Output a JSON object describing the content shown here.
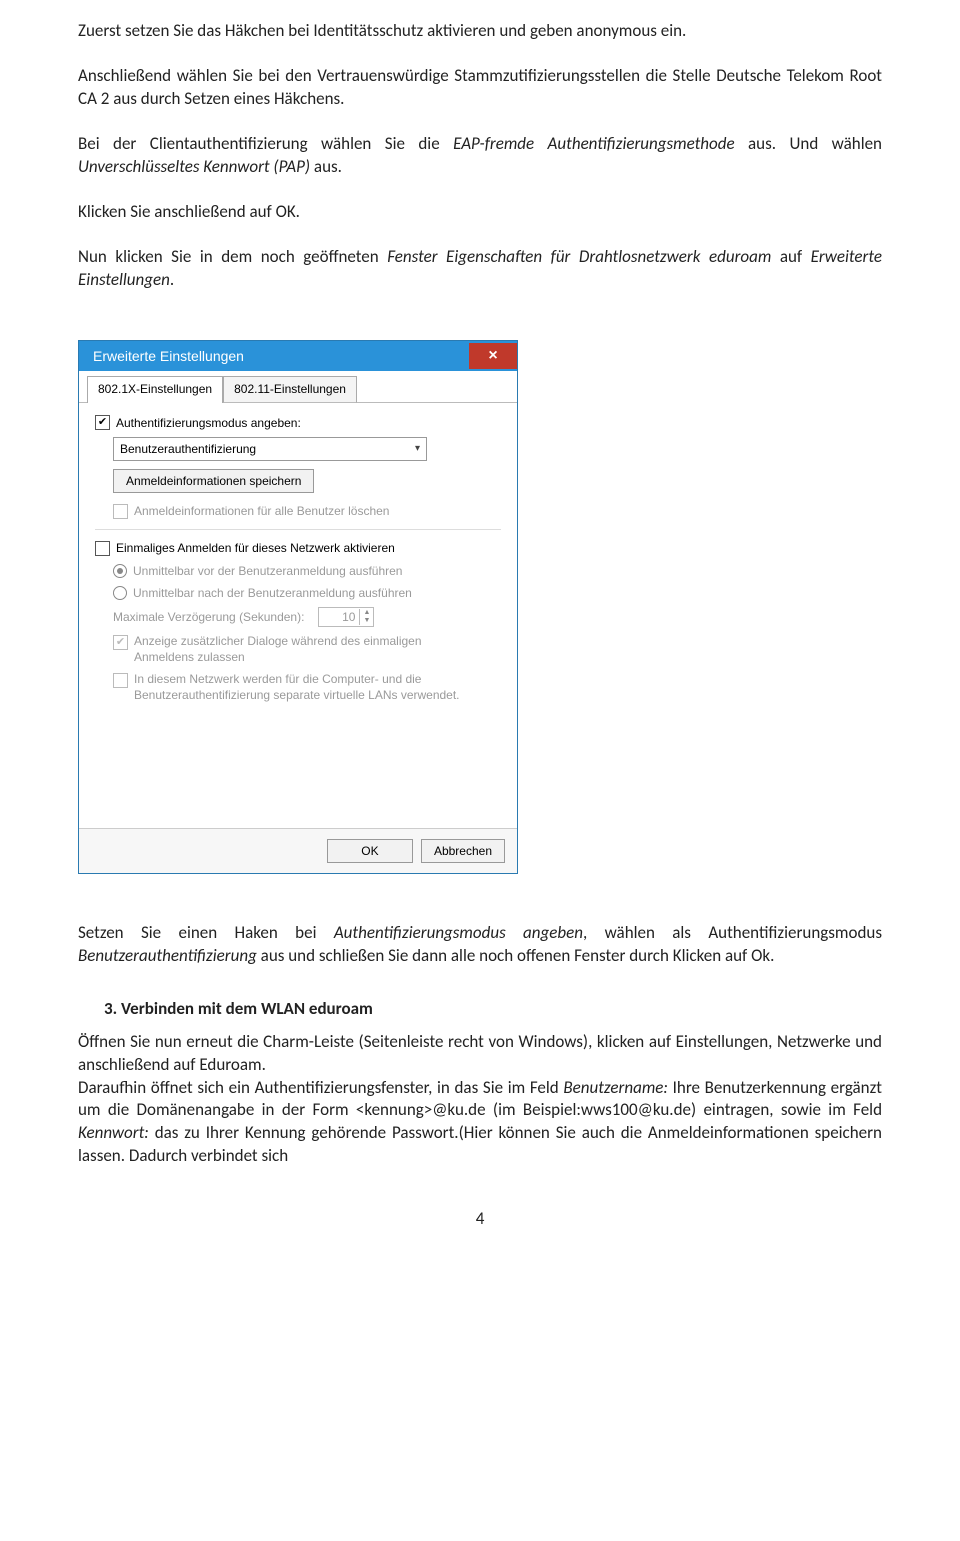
{
  "doc": {
    "p1": "Zuerst setzen Sie das Häkchen bei Identitätsschutz aktivieren und geben anonymous ein.",
    "p2": "Anschließend wählen Sie bei den Vertrauenswürdige Stammzutifizierungsstellen die Stelle  Deutsche Telekom Root CA 2 aus durch Setzen eines Häkchens.",
    "p3_a": "Bei der Clientauthentifizierung wählen Sie die ",
    "p3_i1": "EAP-fremde Authentifizierungsmethode",
    "p3_b": " aus. Und wählen ",
    "p3_i2": "Unverschlüsseltes Kennwort (PAP)",
    "p3_c": " aus.",
    "p4": "Klicken Sie anschließend auf OK.",
    "p5_a": "Nun klicken Sie in dem noch geöffneten ",
    "p5_i1": "Fenster Eigenschaften für Drahtlosnetzwerk eduroam",
    "p5_b": " auf ",
    "p5_i2": "Erweiterte Einstellungen",
    "p5_c": ".",
    "p6_a": "Setzen Sie einen Haken bei ",
    "p6_i1": "Authentifizierungsmodus angeben",
    "p6_b": ",  wählen als Authentifizierungsmodus ",
    "p6_i2": "Benutzerauthentifizierung",
    "p6_c": " aus und schließen Sie dann alle noch offenen  Fenster durch Klicken auf Ok.",
    "sec3": "3.   Verbinden mit dem WLAN eduroam",
    "p7": "Öffnen Sie nun erneut die Charm-Leiste (Seitenleiste recht von Windows), klicken auf Einstellungen, Netzwerke und anschließend auf Eduroam.",
    "p8_a": "Daraufhin öffnet sich ein Authentifizierungsfenster, in das Sie im Feld ",
    "p8_i1": "Benutzername:",
    "p8_b": " Ihre Benutzerkennung ergänzt um die Domänenangabe in der Form <kennung>@ku.de (im Beispiel:wws100@ku.de) eintragen, sowie im Feld ",
    "p8_i2": "Kennwort:",
    "p8_c": " das zu Ihrer Kennung gehörende Passwort.(Hier können Sie auch die Anmeldeinformationen speichern lassen. Dadurch verbindet sich",
    "pagenum": "4"
  },
  "dialog": {
    "title": "Erweiterte Einstellungen",
    "close": "×",
    "tabs": {
      "t1": "802.1X-Einstellungen",
      "t2": "802.11-Einstellungen"
    },
    "chk_authmode": "Authentifizierungsmodus angeben:",
    "combo_value": "Benutzerauthentifizierung",
    "btn_savecred": "Anmeldeinformationen speichern",
    "chk_delcred": "Anmeldeinformationen für alle Benutzer löschen",
    "chk_sso": "Einmaliges Anmelden für dieses Netzwerk aktivieren",
    "radio_before": "Unmittelbar vor der Benutzeranmeldung ausführen",
    "radio_after": "Unmittelbar nach der Benutzeranmeldung ausführen",
    "lbl_maxdelay": "Maximale Verzögerung (Sekunden):",
    "spin_value": "10",
    "chk_dialogs": "Anzeige zusätzlicher Dialoge während des einmaligen Anmeldens zulassen",
    "chk_vlans": "In diesem Netzwerk werden für die Computer- und die Benutzerauthentifizierung separate virtuelle LANs verwendet.",
    "btn_ok": "OK",
    "btn_cancel": "Abbrechen"
  }
}
